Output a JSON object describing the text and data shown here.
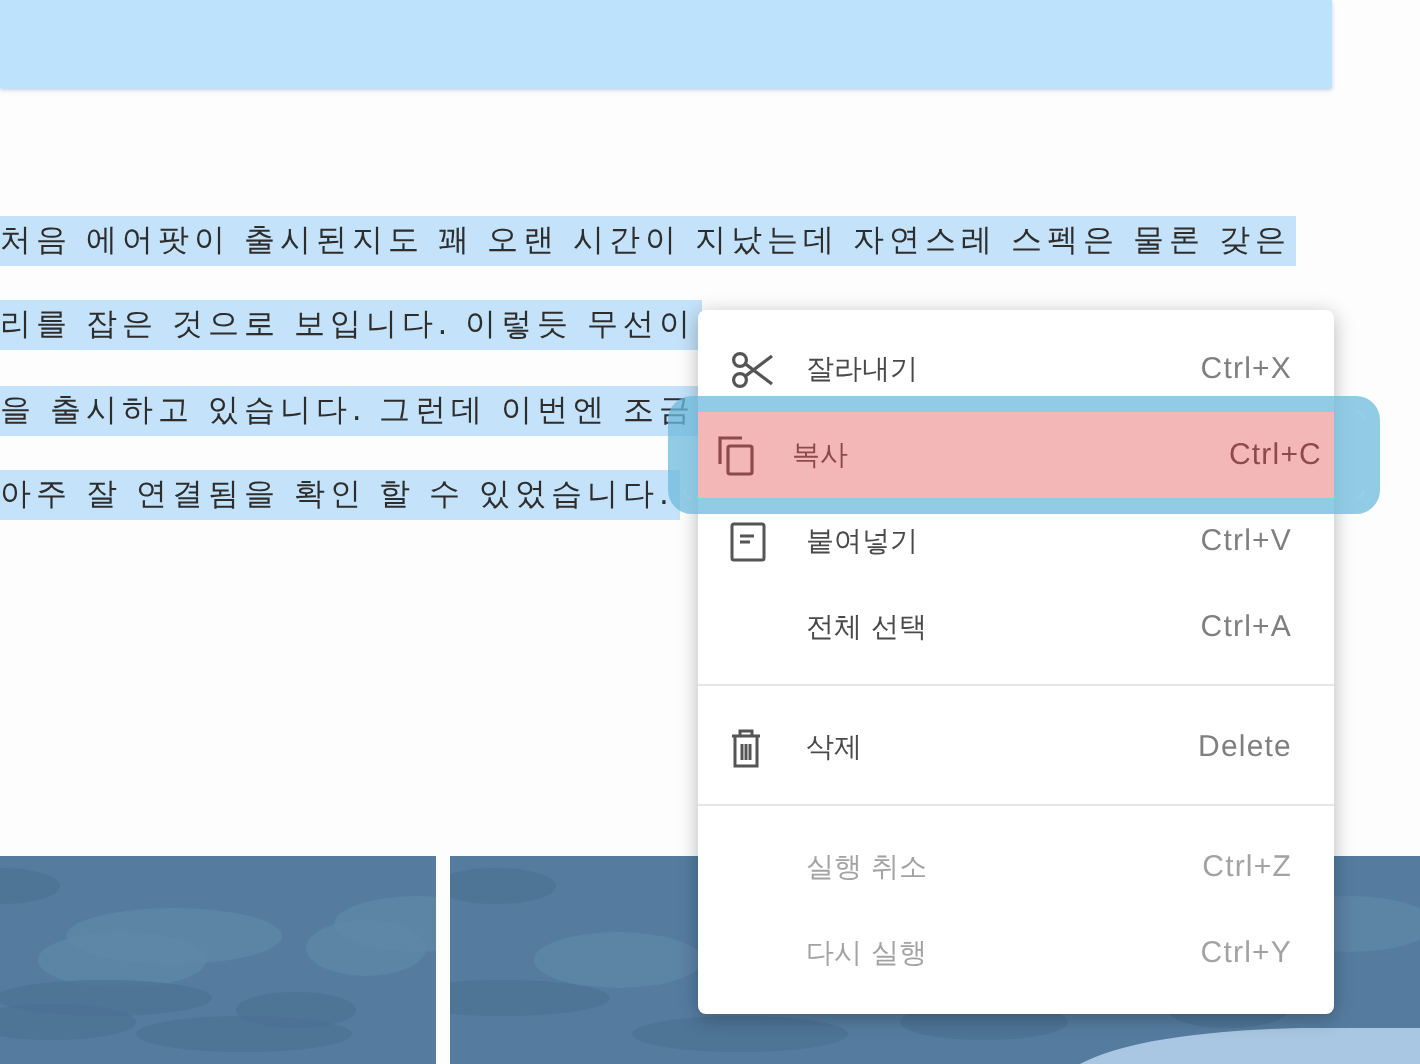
{
  "document": {
    "paragraph_lines": [
      "처음 에어팟이 출시된지도 꽤 오랜 시간이 지났는데 자연스레 스펙은 물론 갖은",
      "리를 잡은 것으로 보입니다.  이렇듯 무선이",
      "을 출시하고 있습니다.  그런데 이번엔 조금",
      "아주 잘 연결됨을 확인 할 수 있었습니다."
    ]
  },
  "context_menu": {
    "items": [
      {
        "kind": "command",
        "label": "잘라내기",
        "shortcut": "Ctrl+X",
        "selected": false,
        "disabled": false
      },
      {
        "kind": "command",
        "label": "복사",
        "shortcut": "Ctrl+C",
        "selected": true,
        "disabled": false
      },
      {
        "kind": "command",
        "label": "붙여넣기",
        "shortcut": "Ctrl+V",
        "selected": false,
        "disabled": false
      },
      {
        "kind": "command",
        "label": "전체 선택",
        "shortcut": "Ctrl+A",
        "selected": false,
        "disabled": false
      },
      {
        "kind": "divider"
      },
      {
        "kind": "command",
        "label": "삭제",
        "shortcut": "Delete",
        "selected": false,
        "disabled": false
      },
      {
        "kind": "divider"
      },
      {
        "kind": "command",
        "label": "실행 취소",
        "shortcut": "Ctrl+Z",
        "selected": false,
        "disabled": true
      },
      {
        "kind": "command",
        "label": "다시 실행",
        "shortcut": "Ctrl+Y",
        "selected": false,
        "disabled": true
      }
    ]
  }
}
